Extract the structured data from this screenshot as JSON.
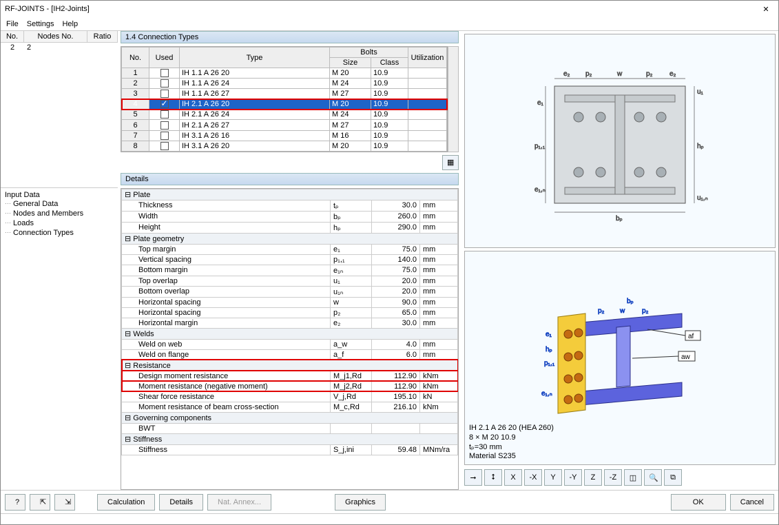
{
  "window": {
    "title": "RF-JOINTS - [IH2-Joints]"
  },
  "menu": [
    "File",
    "Settings",
    "Help"
  ],
  "leftGrid": {
    "cols": [
      "No.",
      "Nodes No.",
      "Ratio"
    ],
    "rows": [
      [
        "2",
        "2",
        ""
      ]
    ]
  },
  "tree": {
    "title": "Input Data",
    "items": [
      "General Data",
      "Nodes and Members",
      "Loads",
      "Connection Types"
    ]
  },
  "centerTitle": "1.4 Connection Types",
  "connCols": {
    "no": "No.",
    "used": "Used",
    "type": "Type",
    "bolts": "Bolts",
    "size": "Size",
    "class": "Class",
    "util": "Utilization"
  },
  "connRows": [
    {
      "no": "1",
      "used": false,
      "type": "IH 1.1 A 26 20",
      "size": "M 20",
      "class": "10.9",
      "util": ""
    },
    {
      "no": "2",
      "used": false,
      "type": "IH 1.1 A 26 24",
      "size": "M 24",
      "class": "10.9",
      "util": ""
    },
    {
      "no": "3",
      "used": false,
      "type": "IH 1.1 A 26 27",
      "size": "M 27",
      "class": "10.9",
      "util": ""
    },
    {
      "no": "4",
      "used": true,
      "type": "IH 2.1 A 26 20",
      "size": "M 20",
      "class": "10.9",
      "util": ""
    },
    {
      "no": "5",
      "used": false,
      "type": "IH 2.1 A 26 24",
      "size": "M 24",
      "class": "10.9",
      "util": ""
    },
    {
      "no": "6",
      "used": false,
      "type": "IH 2.1 A 26 27",
      "size": "M 27",
      "class": "10.9",
      "util": ""
    },
    {
      "no": "7",
      "used": false,
      "type": "IH 3.1 A 26 16",
      "size": "M 16",
      "class": "10.9",
      "util": ""
    },
    {
      "no": "8",
      "used": false,
      "type": "IH 3.1 A 26 20",
      "size": "M 20",
      "class": "10.9",
      "util": ""
    }
  ],
  "detailsTitle": "Details",
  "details": [
    {
      "g": "Plate"
    },
    {
      "n": "Thickness",
      "s": "tₚ",
      "v": "30.0",
      "u": "mm"
    },
    {
      "n": "Width",
      "s": "bₚ",
      "v": "260.0",
      "u": "mm"
    },
    {
      "n": "Height",
      "s": "hₚ",
      "v": "290.0",
      "u": "mm"
    },
    {
      "g": "Plate geometry"
    },
    {
      "n": "Top margin",
      "s": "e₁",
      "v": "75.0",
      "u": "mm"
    },
    {
      "n": "Vertical spacing",
      "s": "p₁,₁",
      "v": "140.0",
      "u": "mm"
    },
    {
      "n": "Bottom margin",
      "s": "e₁ₙ",
      "v": "75.0",
      "u": "mm"
    },
    {
      "n": "Top overlap",
      "s": "u₁",
      "v": "20.0",
      "u": "mm",
      "hl": true
    },
    {
      "n": "Bottom overlap",
      "s": "u₁ₙ",
      "v": "20.0",
      "u": "mm"
    },
    {
      "n": "Horizontal spacing",
      "s": "w",
      "v": "90.0",
      "u": "mm"
    },
    {
      "n": "Horizontal spacing",
      "s": "p₂",
      "v": "65.0",
      "u": "mm"
    },
    {
      "n": "Horizontal margin",
      "s": "e₂",
      "v": "30.0",
      "u": "mm"
    },
    {
      "g": "Welds"
    },
    {
      "n": "Weld on web",
      "s": "a_w",
      "v": "4.0",
      "u": "mm"
    },
    {
      "n": "Weld on flange",
      "s": "a_f",
      "v": "6.0",
      "u": "mm"
    },
    {
      "g": "Resistance",
      "red": true
    },
    {
      "n": "Design moment resistance",
      "s": "M_j1,Rd",
      "v": "112.90",
      "u": "kNm",
      "red": true
    },
    {
      "n": "Moment resistance (negative moment)",
      "s": "M_j2,Rd",
      "v": "112.90",
      "u": "kNm",
      "red": true
    },
    {
      "n": "Shear force resistance",
      "s": "V_j,Rd",
      "v": "195.10",
      "u": "kN"
    },
    {
      "n": "Moment resistance of beam cross-section",
      "s": "M_c,Rd",
      "v": "216.10",
      "u": "kNm"
    },
    {
      "g": "Governing components",
      "sub": true
    },
    {
      "n": "BWT",
      "s": "",
      "v": "",
      "u": ""
    },
    {
      "g": "Stiffness"
    },
    {
      "n": "Stiffness",
      "s": "S_j,ini",
      "v": "59.48",
      "u": "MNm/ra"
    }
  ],
  "preview": {
    "line1": "IH 2.1 A 26 20  (HEA 260)",
    "line2": "8 × M 20 10.9",
    "line3": "tₚ=30 mm",
    "line4": "Material S235",
    "dims": {
      "e2": "e₂",
      "p2": "p₂",
      "w": "w",
      "e1": "e₁",
      "p11": "p₁,₁",
      "e1n": "e₁,ₙ",
      "u1": "u₁",
      "u1n": "u₁,ₙ",
      "hp": "hₚ",
      "bp": "bₚ",
      "af": "af",
      "aw": "aw"
    }
  },
  "viewIcons": [
    "⭢",
    "⭥",
    "X",
    "-X",
    "Y",
    "-Y",
    "Z",
    "-Z",
    "◫",
    "🔍",
    "⧉"
  ],
  "bottom": {
    "calc": "Calculation",
    "details": "Details",
    "annex": "Nat. Annex...",
    "graphics": "Graphics",
    "ok": "OK",
    "cancel": "Cancel"
  }
}
